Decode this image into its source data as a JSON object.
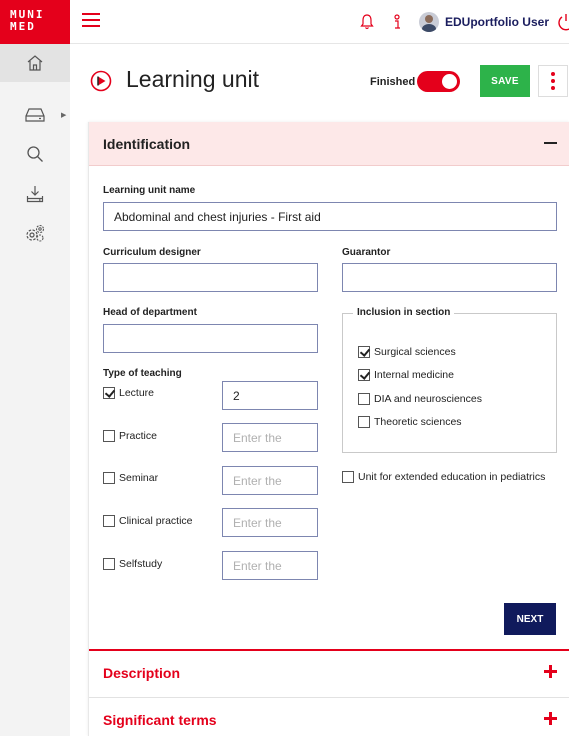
{
  "logo": {
    "line1": "MUNI",
    "line2": "MED"
  },
  "user": {
    "name": "EDUportfolio User"
  },
  "sidebar": {
    "items": [
      {
        "name": "home-icon"
      },
      {
        "name": "inbox-icon"
      },
      {
        "name": "search-icon"
      },
      {
        "name": "download-icon"
      },
      {
        "name": "settings-icon"
      }
    ]
  },
  "header": {
    "title": "Learning unit",
    "finished_label": "Finished",
    "finished_on": true,
    "save_label": "SAVE"
  },
  "identification": {
    "title": "Identification",
    "learning_unit_name_label": "Learning unit name",
    "learning_unit_name_value": "Abdominal and chest injuries - First aid",
    "curriculum_designer_label": "Curriculum designer",
    "curriculum_designer_value": "",
    "guarantor_label": "Guarantor",
    "guarantor_value": "",
    "head_of_department_label": "Head of department",
    "head_of_department_value": "",
    "inclusion_label": "Inclusion in section",
    "inclusion_options": [
      {
        "label": "Surgical sciences",
        "checked": true
      },
      {
        "label": "Internal medicine",
        "checked": true
      },
      {
        "label": "DIA and neurosciences",
        "checked": false
      },
      {
        "label": "Theoretic sciences",
        "checked": false
      }
    ],
    "extended_pediatrics_label": "Unit for extended education in pediatrics",
    "extended_pediatrics_checked": false,
    "type_of_teaching_label": "Type of teaching",
    "teaching_types": [
      {
        "label": "Lecture",
        "checked": true,
        "value": "2",
        "placeholder": "Enter the"
      },
      {
        "label": "Practice",
        "checked": false,
        "value": "",
        "placeholder": "Enter the"
      },
      {
        "label": "Seminar",
        "checked": false,
        "value": "",
        "placeholder": "Enter the"
      },
      {
        "label": "Clinical practice",
        "checked": false,
        "value": "",
        "placeholder": "Enter the"
      },
      {
        "label": "Selfstudy",
        "checked": false,
        "value": "",
        "placeholder": "Enter the"
      }
    ],
    "next_label": "NEXT"
  },
  "sections": {
    "description": "Description",
    "significant_terms": "Significant terms"
  },
  "colors": {
    "accent_red": "#e4001b",
    "save_green": "#2db34a",
    "next_navy": "#101a5c",
    "user_navy": "#1a1d5e"
  }
}
